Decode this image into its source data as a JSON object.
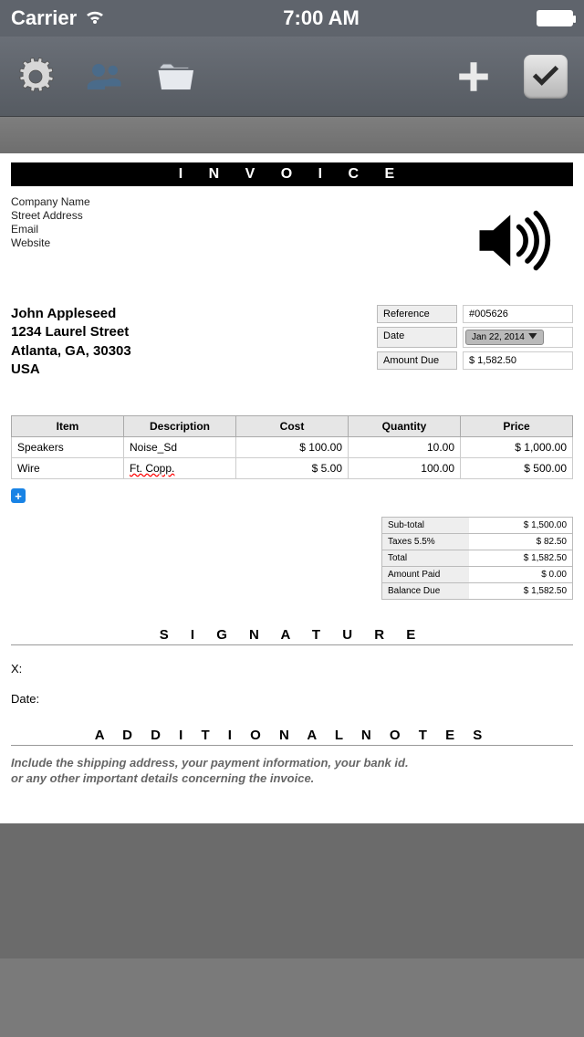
{
  "statusbar": {
    "carrier": "Carrier",
    "time": "7:00 AM"
  },
  "document": {
    "title": "I N V O I C E",
    "company_lines": [
      "Company Name",
      "Street Address",
      "Email",
      "Website"
    ],
    "bill_to": [
      "John Appleseed",
      "1234 Laurel Street",
      "Atlanta, GA, 30303",
      "USA"
    ],
    "meta": {
      "reference_label": "Reference",
      "reference_value": "#005626",
      "date_label": "Date",
      "date_value": "Jan 22, 2014",
      "amount_due_label": "Amount Due",
      "amount_due_value": "$ 1,582.50"
    },
    "table": {
      "headers": {
        "item": "Item",
        "desc": "Description",
        "cost": "Cost",
        "qty": "Quantity",
        "price": "Price"
      },
      "rows": [
        {
          "item": "Speakers",
          "desc": "Noise_Sd",
          "cost": "$ 100.00",
          "qty": "10.00",
          "price": "$ 1,000.00"
        },
        {
          "item": "Wire",
          "desc": "Ft. Copp.",
          "cost": "$ 5.00",
          "qty": "100.00",
          "price": "$ 500.00"
        }
      ]
    },
    "totals": {
      "subtotal_label": "Sub-total",
      "subtotal": "$ 1,500.00",
      "taxes_label": "Taxes 5.5%",
      "taxes": "$ 82.50",
      "total_label": "Total",
      "total": "$ 1,582.50",
      "paid_label": "Amount Paid",
      "paid": "$ 0.00",
      "balance_label": "Balance Due",
      "balance": "$ 1,582.50"
    },
    "signature": {
      "title": "S I G N A T U R E",
      "x": "X:",
      "date": "Date:"
    },
    "notes": {
      "title": "A D D I T I O N A L   N O T E S",
      "line1": "Include the shipping address, your payment information, your bank id.",
      "line2": "or any other important details concerning the invoice."
    },
    "add_label": "+"
  }
}
